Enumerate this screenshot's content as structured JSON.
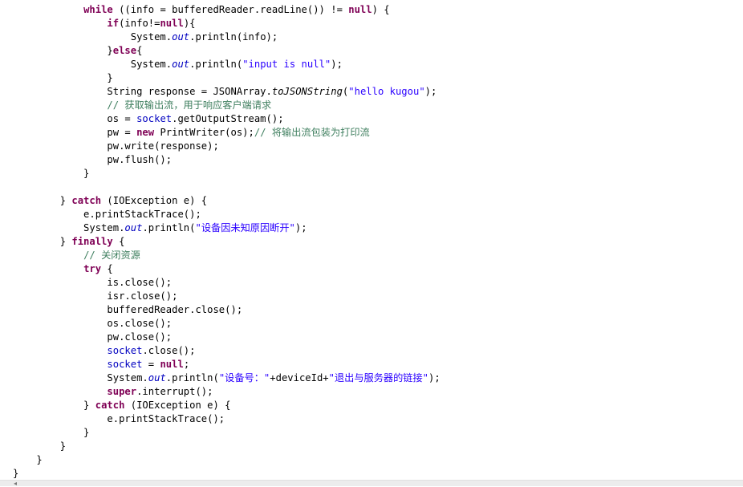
{
  "code": {
    "lines": [
      [
        [
          "",
          "            "
        ],
        [
          "kw",
          "while"
        ],
        [
          "",
          " ((info = bufferedReader.readLine()) != "
        ],
        [
          "kw",
          "null"
        ],
        [
          "",
          ") {"
        ]
      ],
      [
        [
          "",
          "                "
        ],
        [
          "kw",
          "if"
        ],
        [
          "",
          "(info!="
        ],
        [
          "kw",
          "null"
        ],
        [
          "",
          "){"
        ]
      ],
      [
        [
          "",
          "                    System."
        ],
        [
          "static",
          "out"
        ],
        [
          "",
          ".println(info);"
        ]
      ],
      [
        [
          "",
          "                }"
        ],
        [
          "kw",
          "else"
        ],
        [
          "",
          "{"
        ]
      ],
      [
        [
          "",
          "                    System."
        ],
        [
          "static",
          "out"
        ],
        [
          "",
          ".println("
        ],
        [
          "str",
          "\"input is null\""
        ],
        [
          "",
          ");"
        ]
      ],
      [
        [
          "",
          "                }"
        ]
      ],
      [
        [
          "",
          "                String response = JSONArray."
        ],
        [
          "method-static",
          "toJSONString"
        ],
        [
          "",
          "("
        ],
        [
          "str",
          "\"hello kugou\""
        ],
        [
          "",
          ");"
        ]
      ],
      [
        [
          "",
          "                "
        ],
        [
          "comment",
          "// "
        ],
        [
          "comment-cjk",
          "获取输出流，用于响应客户端请求"
        ]
      ],
      [
        [
          "",
          "                os = "
        ],
        [
          "field",
          "socket"
        ],
        [
          "",
          ".getOutputStream();"
        ]
      ],
      [
        [
          "",
          "                pw = "
        ],
        [
          "kw",
          "new"
        ],
        [
          "",
          " PrintWriter(os);"
        ],
        [
          "comment",
          "// "
        ],
        [
          "comment-cjk",
          "将输出流包装为打印流"
        ]
      ],
      [
        [
          "",
          "                pw.write(response);"
        ]
      ],
      [
        [
          "",
          "                pw.flush();"
        ]
      ],
      [
        [
          "",
          "            }"
        ]
      ],
      [
        [
          "",
          ""
        ]
      ],
      [
        [
          "",
          "        } "
        ],
        [
          "kw",
          "catch"
        ],
        [
          "",
          " (IOException e) {"
        ]
      ],
      [
        [
          "",
          "            e.printStackTrace();"
        ]
      ],
      [
        [
          "",
          "            System."
        ],
        [
          "static",
          "out"
        ],
        [
          "",
          ".println("
        ],
        [
          "str",
          "\""
        ],
        [
          "str-cjk",
          "设备因未知原因断开"
        ],
        [
          "str",
          "\""
        ],
        [
          "",
          ");"
        ]
      ],
      [
        [
          "",
          "        } "
        ],
        [
          "kw",
          "finally"
        ],
        [
          "",
          " {"
        ]
      ],
      [
        [
          "",
          "            "
        ],
        [
          "comment",
          "// "
        ],
        [
          "comment-cjk",
          "关闭资源"
        ]
      ],
      [
        [
          "",
          "            "
        ],
        [
          "kw",
          "try"
        ],
        [
          "",
          " {"
        ]
      ],
      [
        [
          "",
          "                is.close();"
        ]
      ],
      [
        [
          "",
          "                isr.close();"
        ]
      ],
      [
        [
          "",
          "                bufferedReader.close();"
        ]
      ],
      [
        [
          "",
          "                os.close();"
        ]
      ],
      [
        [
          "",
          "                pw.close();"
        ]
      ],
      [
        [
          "",
          "                "
        ],
        [
          "field",
          "socket"
        ],
        [
          "",
          ".close();"
        ]
      ],
      [
        [
          "",
          "                "
        ],
        [
          "field",
          "socket"
        ],
        [
          "",
          " = "
        ],
        [
          "kw",
          "null"
        ],
        [
          "",
          ";"
        ]
      ],
      [
        [
          "",
          "                System."
        ],
        [
          "static",
          "out"
        ],
        [
          "",
          ".println("
        ],
        [
          "str",
          "\""
        ],
        [
          "str-cjk",
          "设备号："
        ],
        [
          "str",
          "\""
        ],
        [
          "",
          "+deviceId+"
        ],
        [
          "str",
          "\""
        ],
        [
          "str-cjk",
          "退出与服务器的链接"
        ],
        [
          "str",
          "\""
        ],
        [
          "",
          ");"
        ]
      ],
      [
        [
          "",
          "                "
        ],
        [
          "kw",
          "super"
        ],
        [
          "",
          ".interrupt();"
        ]
      ],
      [
        [
          "",
          "            } "
        ],
        [
          "kw",
          "catch"
        ],
        [
          "",
          " (IOException e) {"
        ]
      ],
      [
        [
          "",
          "                e.printStackTrace();"
        ]
      ],
      [
        [
          "",
          "            }"
        ]
      ],
      [
        [
          "",
          "        }"
        ]
      ],
      [
        [
          "",
          "    }"
        ]
      ],
      [
        [
          "",
          "}"
        ]
      ]
    ]
  },
  "scrollbar": {
    "left_arrow_glyph": "◂"
  },
  "colors": {
    "keyword": "#7f0055",
    "string": "#2a00ff",
    "comment": "#3f7f5f",
    "field": "#0000c0"
  }
}
